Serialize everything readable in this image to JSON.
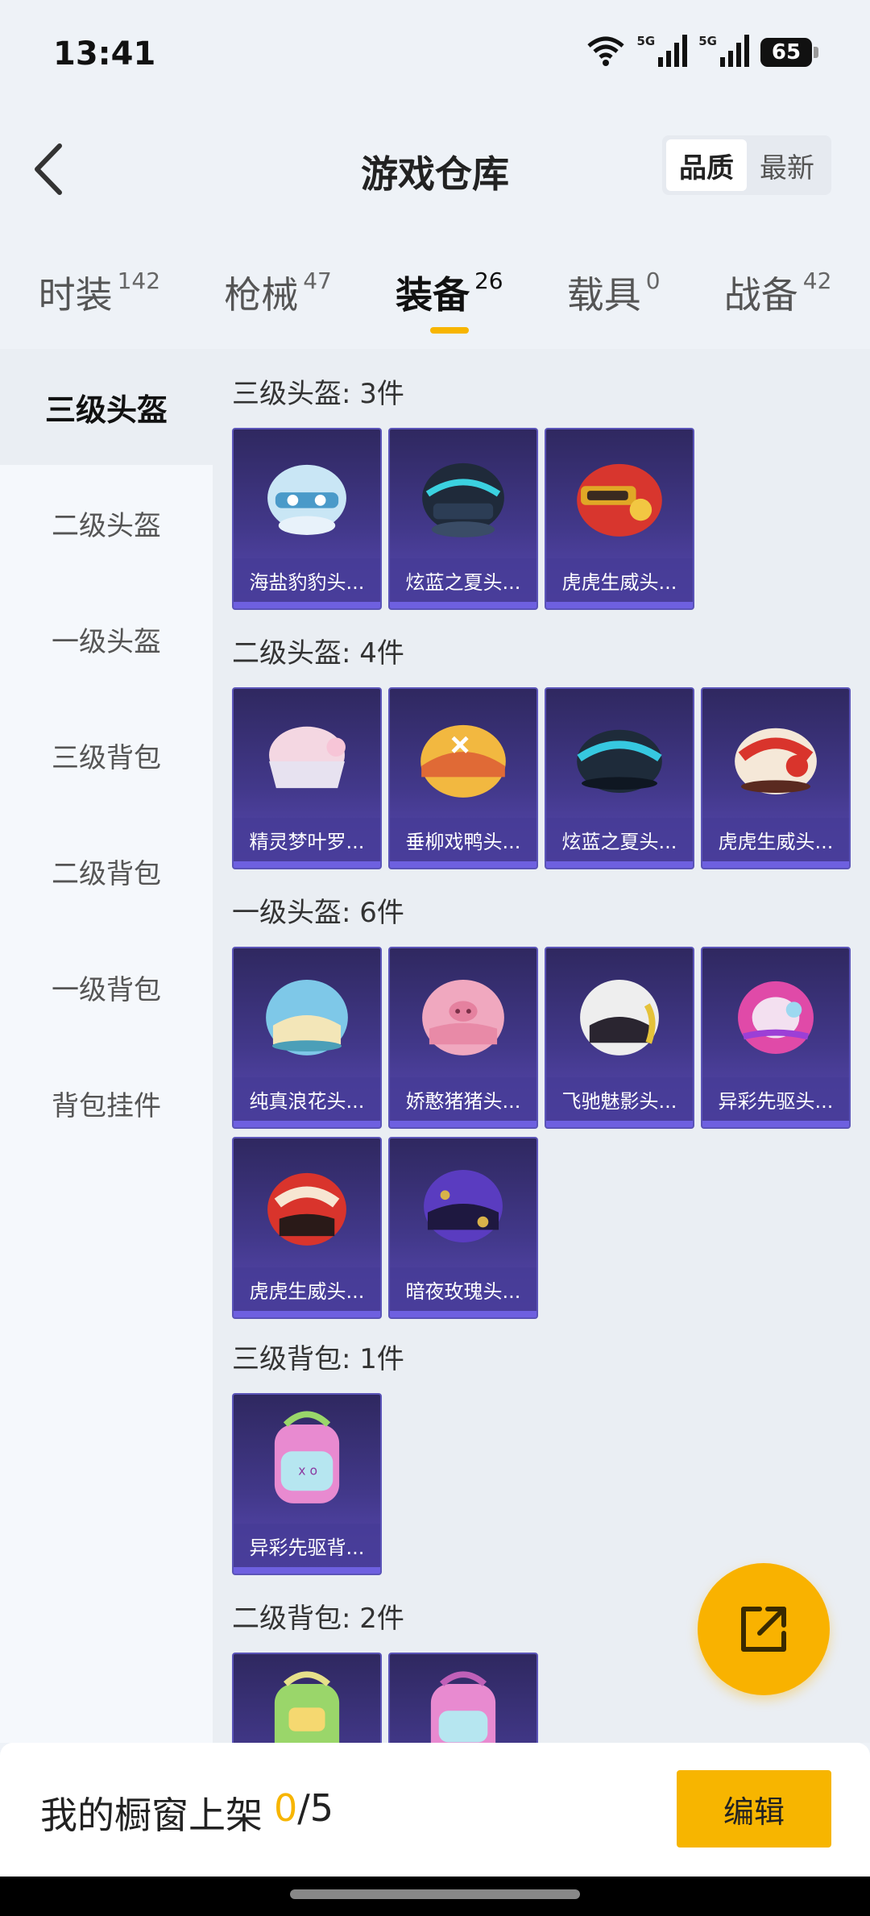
{
  "status_bar": {
    "time": "13:41",
    "network_1": "5G",
    "network_2": "5G",
    "battery": "65"
  },
  "header": {
    "title": "游戏仓库",
    "sort_options": [
      "品质",
      "最新"
    ],
    "active_sort": "品质"
  },
  "tabs": [
    {
      "label": "时装",
      "count": "142"
    },
    {
      "label": "枪械",
      "count": "47"
    },
    {
      "label": "装备",
      "count": "26",
      "active": true
    },
    {
      "label": "载具",
      "count": "0"
    },
    {
      "label": "战备",
      "count": "42"
    }
  ],
  "sidebar": {
    "items": [
      "三级头盔",
      "二级头盔",
      "一级头盔",
      "三级背包",
      "二级背包",
      "一级背包",
      "背包挂件"
    ]
  },
  "sections": [
    {
      "title": "三级头盔: 3件",
      "items": [
        "海盐豹豹头...",
        "炫蓝之夏头...",
        "虎虎生威头..."
      ]
    },
    {
      "title": "二级头盔: 4件",
      "items": [
        "精灵梦叶罗...",
        "垂柳戏鸭头...",
        "炫蓝之夏头...",
        "虎虎生威头..."
      ]
    },
    {
      "title": "一级头盔: 6件",
      "items": [
        "纯真浪花头...",
        "娇憨猪猪头...",
        "飞驰魅影头...",
        "异彩先驱头...",
        "虎虎生威头...",
        "暗夜玫瑰头..."
      ]
    },
    {
      "title": "三级背包: 1件",
      "items": [
        "异彩先驱背..."
      ]
    },
    {
      "title": "二级背包: 2件",
      "items": [
        "",
        ""
      ]
    }
  ],
  "bottom_bar": {
    "label": "我的橱窗上架",
    "count": "0",
    "max": "/5",
    "edit_label": "编辑"
  },
  "colors": {
    "accent": "#f7b500",
    "card_bg": "#42388a",
    "card_border": "#5b54b8"
  }
}
